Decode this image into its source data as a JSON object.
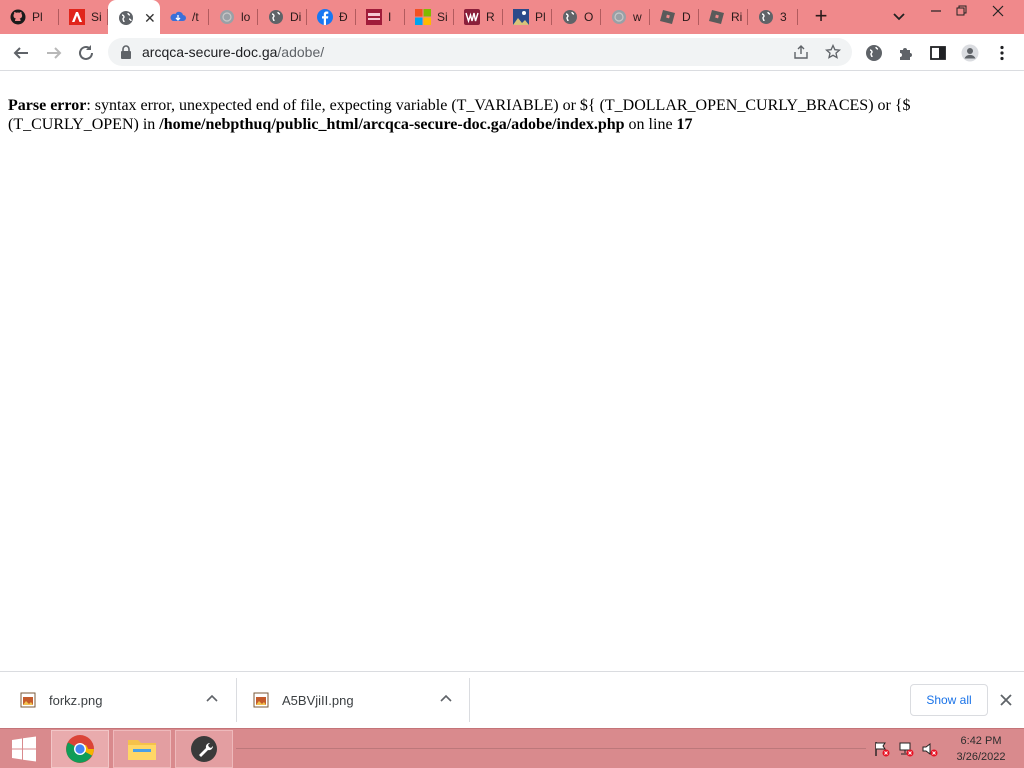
{
  "tabs": [
    {
      "icon": "github-icon",
      "title": "Pl"
    },
    {
      "icon": "adobe-icon",
      "title": "Si"
    },
    {
      "icon": "globe-icon",
      "title": "",
      "active": true
    },
    {
      "icon": "cloud-icon",
      "title": "/t"
    },
    {
      "icon": "globe-grey-icon",
      "title": "lo"
    },
    {
      "icon": "globe-icon",
      "title": "Di"
    },
    {
      "icon": "facebook-icon",
      "title": "Đ"
    },
    {
      "icon": "shop-icon",
      "title": "I"
    },
    {
      "icon": "microsoft-icon",
      "title": "Si"
    },
    {
      "icon": "w-icon",
      "title": "R"
    },
    {
      "icon": "image-icon",
      "title": "Pl"
    },
    {
      "icon": "globe-icon",
      "title": "O"
    },
    {
      "icon": "globe-grey-icon",
      "title": "w"
    },
    {
      "icon": "roblox-icon",
      "title": "D"
    },
    {
      "icon": "roblox-icon",
      "title": "Ri"
    },
    {
      "icon": "globe-icon",
      "title": "3"
    }
  ],
  "toolbar": {
    "url_host": "arcqca-secure-doc.ga",
    "url_path": "/adobe/"
  },
  "page": {
    "error_label": "Parse error",
    "error_text": ": syntax error, unexpected end of file, expecting variable (T_VARIABLE) or ${ (T_DOLLAR_OPEN_CURLY_BRACES) or {$ (T_CURLY_OPEN) in ",
    "error_path": "/home/nebpthuq/public_html/arcqca-secure-doc.ga/adobe/index.php",
    "error_line_text": " on line ",
    "error_line": "17"
  },
  "downloads": {
    "items": [
      {
        "name": "forkz.png"
      },
      {
        "name": "A5BVjiII.png"
      }
    ],
    "show_all": "Show all"
  },
  "taskbar": {
    "time": "6:42 PM",
    "date": "3/26/2022"
  }
}
